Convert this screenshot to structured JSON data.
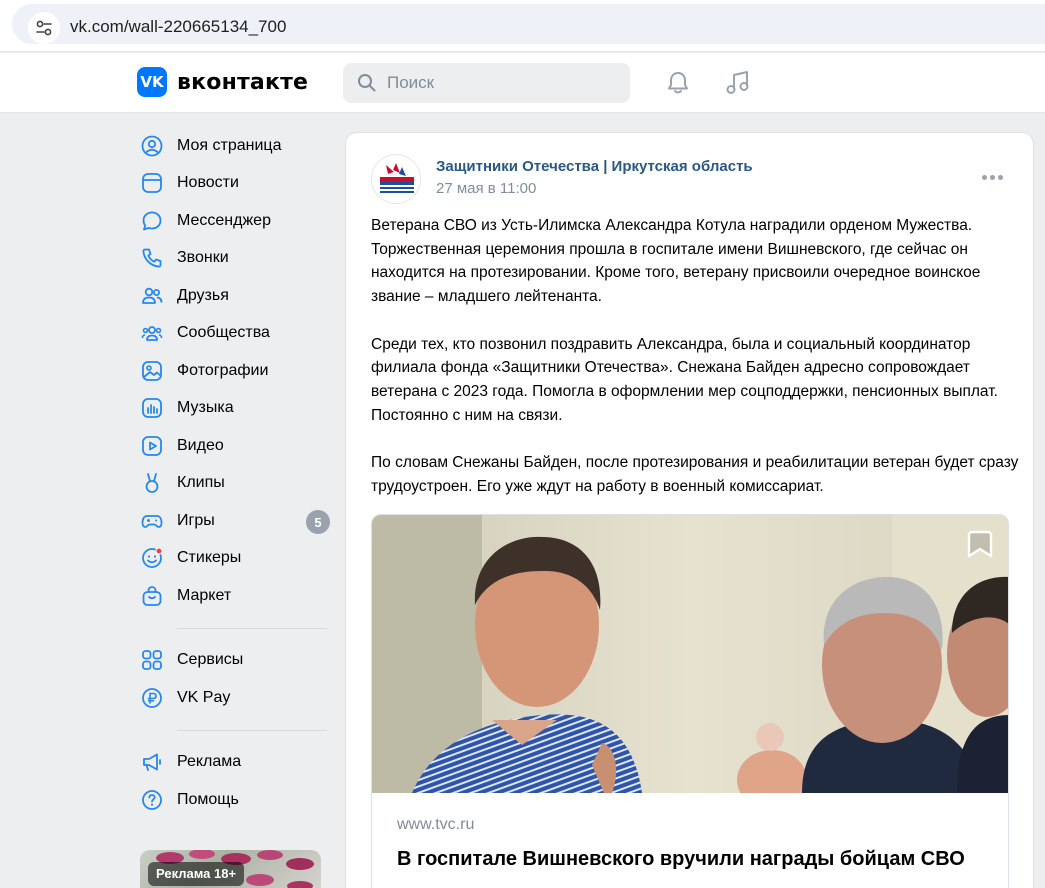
{
  "browser": {
    "url": "vk.com/wall-220665134_700"
  },
  "header": {
    "logo_text": "вконтакте",
    "search_placeholder": "Поиск"
  },
  "sidebar": {
    "items": [
      {
        "label": "Моя страница",
        "icon": "user-circle-icon"
      },
      {
        "label": "Новости",
        "icon": "news-icon"
      },
      {
        "label": "Мессенджер",
        "icon": "message-icon"
      },
      {
        "label": "Звонки",
        "icon": "phone-icon"
      },
      {
        "label": "Друзья",
        "icon": "friends-icon"
      },
      {
        "label": "Сообщества",
        "icon": "communities-icon"
      },
      {
        "label": "Фотографии",
        "icon": "photo-icon"
      },
      {
        "label": "Музыка",
        "icon": "music-icon"
      },
      {
        "label": "Видео",
        "icon": "video-icon"
      },
      {
        "label": "Клипы",
        "icon": "clips-icon"
      },
      {
        "label": "Игры",
        "icon": "games-icon",
        "badge": "5"
      },
      {
        "label": "Стикеры",
        "icon": "stickers-icon"
      },
      {
        "label": "Маркет",
        "icon": "market-icon"
      }
    ],
    "secondary": [
      {
        "label": "Сервисы",
        "icon": "services-icon"
      },
      {
        "label": "VK Pay",
        "icon": "vkpay-icon"
      }
    ],
    "tertiary": [
      {
        "label": "Реклама",
        "icon": "megaphone-icon"
      },
      {
        "label": "Помощь",
        "icon": "help-icon"
      }
    ],
    "ad_label": "Реклама 18+"
  },
  "post": {
    "author": "Защитники Отечества | Иркутская область",
    "date": "27 мая в 11:00",
    "paragraphs": [
      "Ветерана СВО из Усть-Илимска Александра Котула наградили орденом Мужества. Торжественная церемония прошла в госпитале имени Вишневского, где сейчас он находится на протезировании. Кроме того, ветерану присвоили очередное воинское звание – младшего лейтенанта.",
      "Среди тех, кто позвонил поздравить Александра, была и социальный координатор филиала фонда «Защитники Отечества». Снежана Байден адресно сопровождает ветерана с 2023 года. Помогла в оформлении мер соцподдержки, пенсионных выплат. Постоянно с ним на связи.",
      "По словам Снежаны Байден, после протезирования и реабилитации ветеран будет сразу трудоустроен. Его уже ждут на работу в военный комиссариат."
    ],
    "link": {
      "domain": "www.tvc.ru",
      "title": "В госпитале Вишневского вручили награды бойцам СВО"
    }
  },
  "colors": {
    "vk_blue": "#0077ff",
    "link_blue": "#2a5885",
    "secondary_text": "#818c99",
    "page_bg": "#edeef0",
    "icon_blue": "#2688eb"
  }
}
